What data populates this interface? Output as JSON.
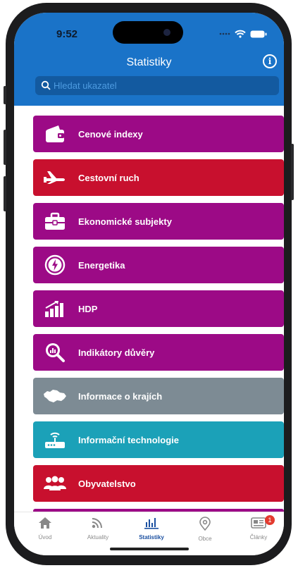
{
  "status": {
    "time": "9:52"
  },
  "header": {
    "title": "Statistiky"
  },
  "search": {
    "placeholder": "Hledat ukazatel"
  },
  "categories": [
    {
      "label": "Cenové indexy",
      "color": "#9c0a86",
      "icon": "wallet-icon"
    },
    {
      "label": "Cestovní ruch",
      "color": "#c8102e",
      "icon": "airplane-icon"
    },
    {
      "label": "Ekonomické subjekty",
      "color": "#9c0a86",
      "icon": "briefcase-icon"
    },
    {
      "label": "Energetika",
      "color": "#9c0a86",
      "icon": "lightning-icon"
    },
    {
      "label": "HDP",
      "color": "#9c0a86",
      "icon": "bar-growth-icon"
    },
    {
      "label": "Indikátory důvěry",
      "color": "#9c0a86",
      "icon": "magnifier-chart-icon"
    },
    {
      "label": "Informace o krajích",
      "color": "#7d8b94",
      "icon": "map-icon"
    },
    {
      "label": "Informační technologie",
      "color": "#1ba1b8",
      "icon": "router-icon"
    },
    {
      "label": "Obyvatelstvo",
      "color": "#c8102e",
      "icon": "people-icon"
    }
  ],
  "tabbar": {
    "items": [
      {
        "label": "Úvod",
        "icon": "home-icon"
      },
      {
        "label": "Aktuality",
        "icon": "feed-icon"
      },
      {
        "label": "Statistiky",
        "icon": "chart-icon"
      },
      {
        "label": "Obce",
        "icon": "location-icon"
      },
      {
        "label": "Články",
        "icon": "articles-icon"
      }
    ],
    "active_index": 2,
    "badge_count": "1"
  }
}
